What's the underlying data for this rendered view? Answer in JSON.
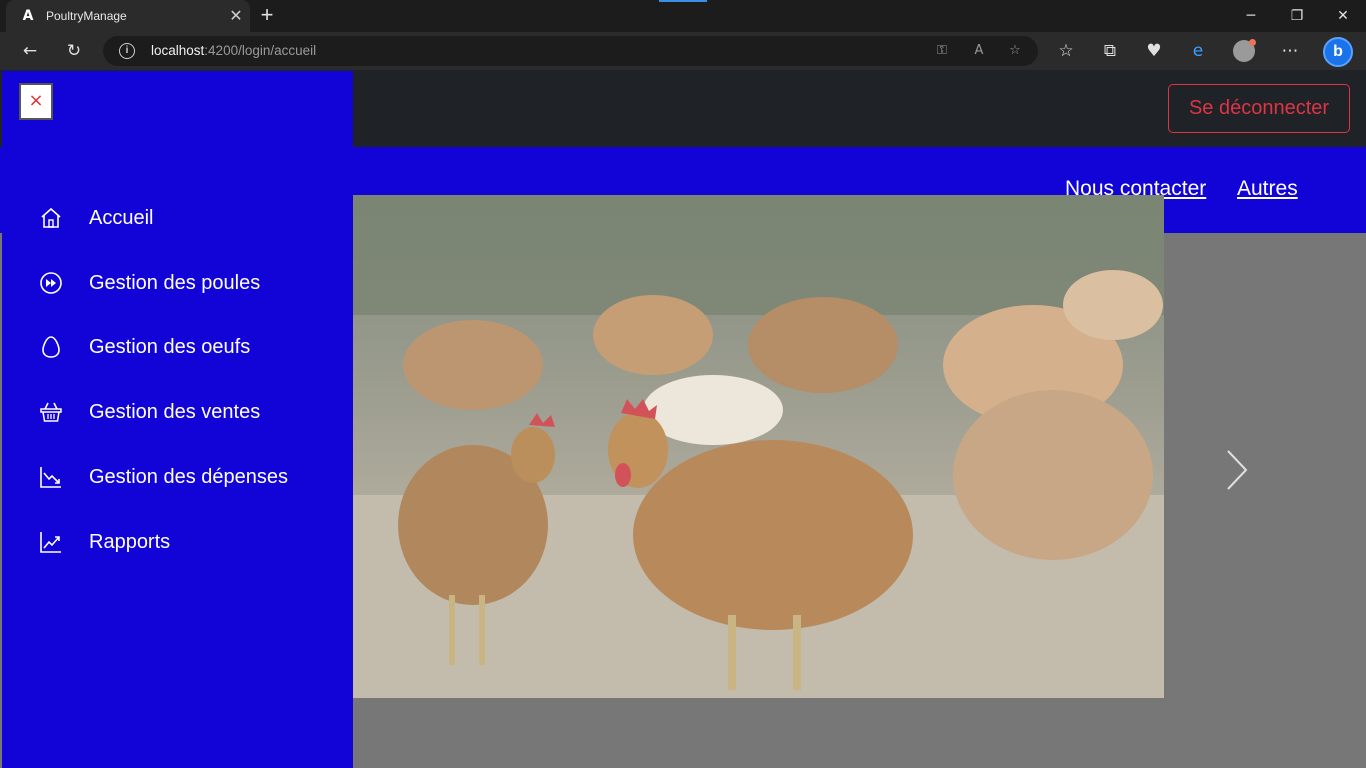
{
  "browser": {
    "tab_title": "PoultryManage",
    "tab_favicon": "A",
    "url_host": "localhost",
    "url_path": ":4200/login/accueil",
    "controls": {
      "minimize": "─",
      "restore": "❐",
      "close": "✕"
    }
  },
  "header": {
    "logout_label": "Se déconnecter"
  },
  "nav": {
    "links": [
      {
        "label": "Nous contacter"
      },
      {
        "label": "Autres"
      }
    ]
  },
  "sidebar": {
    "close_label": "×",
    "items": [
      {
        "label": "Accueil",
        "icon": "home-icon"
      },
      {
        "label": "Gestion des poules",
        "icon": "fast-forward-circle-icon"
      },
      {
        "label": "Gestion des oeufs",
        "icon": "egg-icon"
      },
      {
        "label": "Gestion des ventes",
        "icon": "basket-icon"
      },
      {
        "label": "Gestion des dépenses",
        "icon": "graph-down-icon"
      },
      {
        "label": "Rapports",
        "icon": "graph-up-icon"
      }
    ]
  },
  "carousel": {
    "image_subject": "chickens-image"
  },
  "colors": {
    "brand_blue": "#1204d6",
    "header_dark": "#1f2226",
    "logout_red": "#dc3545"
  }
}
